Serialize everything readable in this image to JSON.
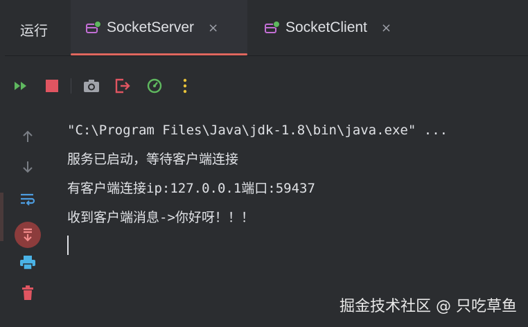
{
  "run_label": "运行",
  "tabs": [
    {
      "label": "SocketServer",
      "close": "×"
    },
    {
      "label": "SocketClient",
      "close": "×"
    }
  ],
  "toolbar": {
    "icons": [
      "rerun-icon",
      "stop-icon",
      "screenshot-icon",
      "exit-icon",
      "profiler-icon",
      "more-icon"
    ]
  },
  "sidebar": {
    "icons": [
      "up-arrow-icon",
      "down-arrow-icon",
      "soft-wrap-icon",
      "scroll-to-end-icon",
      "print-icon",
      "trash-icon"
    ]
  },
  "console": {
    "lines": [
      "\"C:\\Program Files\\Java\\jdk-1.8\\bin\\java.exe\" ...",
      "服务已启动，等待客户端连接",
      "有客户端连接ip:127.0.0.1端口:59437",
      "收到客户端消息->你好呀！！！"
    ]
  },
  "watermark": "掘金技术社区 @ 只吃草鱼",
  "colors": {
    "accent_underline": "#e0675e",
    "run_green": "#5fb85f",
    "stop_red": "#e05561",
    "icon_blue": "#4d9de0",
    "icon_purple": "#c26fd4"
  }
}
